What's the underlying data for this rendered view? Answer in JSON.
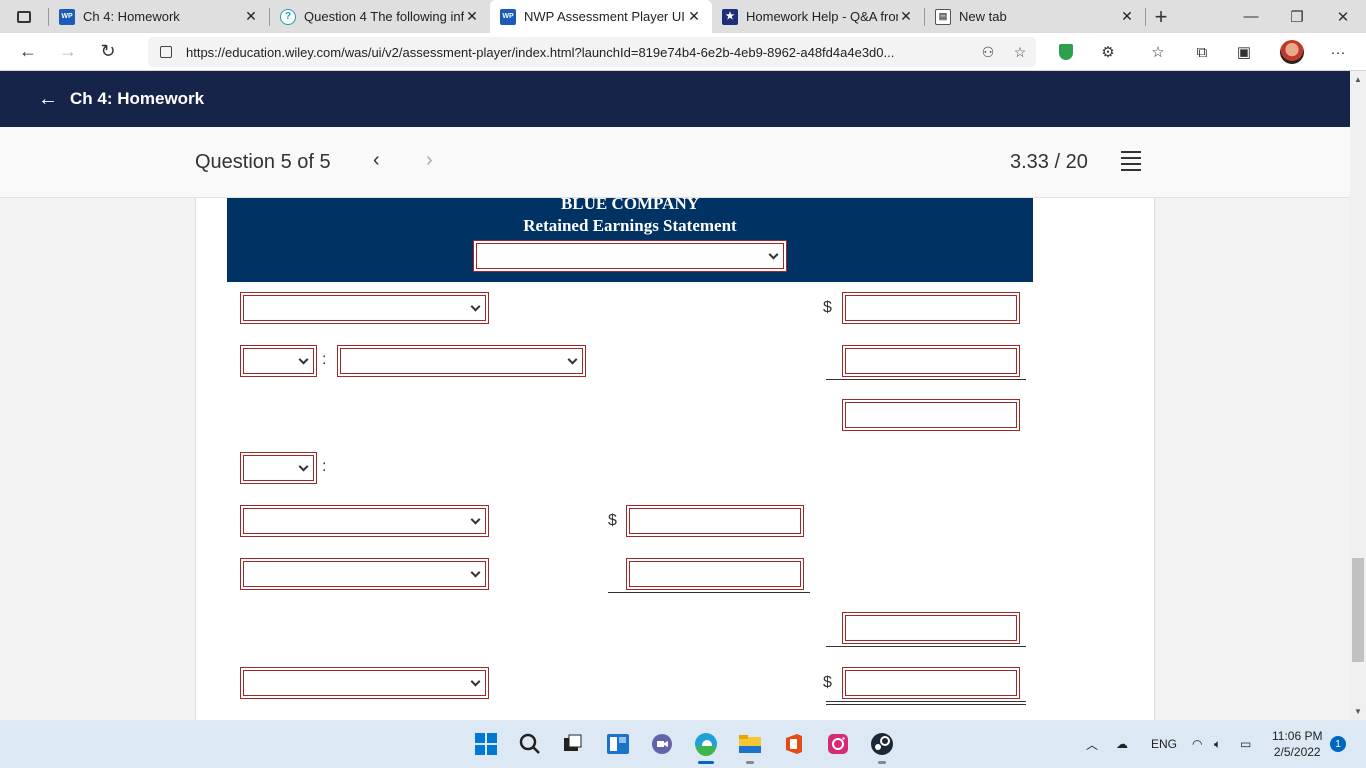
{
  "browser": {
    "tabs": [
      {
        "title": "Ch 4: Homework",
        "favicon": "WP",
        "favicon_color": "#1a5bb5"
      },
      {
        "title": "Question 4 The following info",
        "favicon": "?",
        "favicon_color": "#17a2b8"
      },
      {
        "title": "NWP Assessment Player UI Ap",
        "favicon": "WP",
        "favicon_color": "#1a5bb5",
        "active": true
      },
      {
        "title": "Homework Help - Q&A from",
        "favicon": "★",
        "favicon_color": "#1f2e7a"
      },
      {
        "title": "New tab",
        "favicon": "▤",
        "favicon_color": "#666"
      }
    ],
    "url": "https://education.wiley.com/was/ui/v2/assessment-player/index.html?launchId=819e74b4-6e2b-4eb9-8962-a48fd4a4e3d0..."
  },
  "app": {
    "back_title": "Ch 4: Homework"
  },
  "question": {
    "counter": "Question 5 of 5",
    "score": "3.33 / 20"
  },
  "statement": {
    "company": "BLUE COMPANY",
    "title": "Retained Earnings Statement",
    "dollar_sign": "$",
    "colon": ":"
  },
  "taskbar": {
    "language": "ENG",
    "time": "11:06 PM",
    "date": "2/5/2022",
    "notification_count": "1"
  },
  "colors": {
    "header_bg": "#172449",
    "statement_header_bg": "#003264",
    "input_border": "#a12828"
  }
}
